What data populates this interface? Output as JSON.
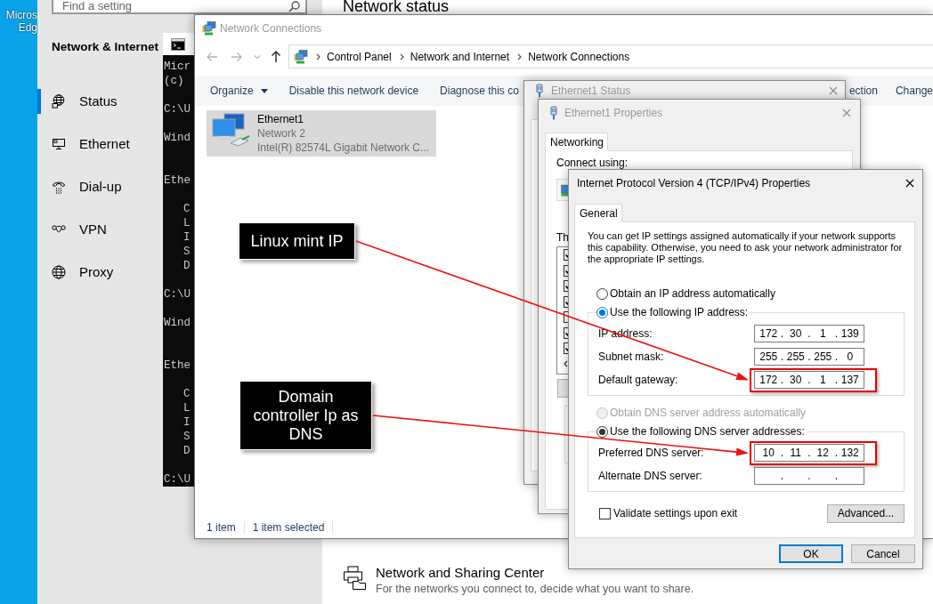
{
  "desktop": {
    "icon_label": [
      "Micros",
      "Edg"
    ]
  },
  "settings": {
    "search_placeholder": "Find a setting",
    "section_title": "Network & Internet",
    "nav": [
      {
        "label": "Status",
        "selected": true
      },
      {
        "label": "Ethernet",
        "selected": false
      },
      {
        "label": "Dial-up",
        "selected": false
      },
      {
        "label": "VPN",
        "selected": false
      },
      {
        "label": "Proxy",
        "selected": false
      }
    ],
    "page_title": "Network status",
    "links": [
      {
        "title": "Network and Sharing Center",
        "description": "For the networks you connect to, decide what you want to share."
      }
    ]
  },
  "terminal": {
    "lines": [
      {
        "kind": "text",
        "text": "Micr"
      },
      {
        "kind": "text",
        "text": "(c)"
      },
      {
        "kind": "blank"
      },
      {
        "kind": "text",
        "text": "C:\\U"
      },
      {
        "kind": "blank"
      },
      {
        "kind": "text",
        "text": "Wind"
      },
      {
        "kind": "blank"
      },
      {
        "kind": "blank"
      },
      {
        "kind": "text",
        "text": "Ethe"
      },
      {
        "kind": "blank"
      },
      {
        "kind": "indented",
        "text": "C"
      },
      {
        "kind": "indented",
        "text": "L"
      },
      {
        "kind": "indented",
        "text": "I"
      },
      {
        "kind": "indented",
        "text": "S"
      },
      {
        "kind": "indented",
        "text": "D"
      },
      {
        "kind": "blank"
      },
      {
        "kind": "text",
        "text": "C:\\U"
      },
      {
        "kind": "blank"
      },
      {
        "kind": "text",
        "text": "Wind"
      },
      {
        "kind": "blank"
      },
      {
        "kind": "blank"
      },
      {
        "kind": "text",
        "text": "Ethe"
      },
      {
        "kind": "blank"
      },
      {
        "kind": "indented",
        "text": "C"
      },
      {
        "kind": "indented",
        "text": "L"
      },
      {
        "kind": "indented",
        "text": "I"
      },
      {
        "kind": "indented",
        "text": "S"
      },
      {
        "kind": "indented",
        "text": "D"
      },
      {
        "kind": "blank"
      },
      {
        "kind": "text",
        "text": "C:\\U"
      }
    ]
  },
  "network_connections": {
    "title": "Network Connections",
    "breadcrumb": [
      "Control Panel",
      "Network and Internet",
      "Network Connections"
    ],
    "toolbar": [
      {
        "label": "Organize",
        "dropdown": true
      },
      {
        "label": "Disable this network device",
        "dropdown": false
      },
      {
        "label": "Diagnose this co",
        "dropdown": false
      },
      {
        "label": "ection",
        "dropdown": false
      },
      {
        "label": "Change",
        "dropdown": false
      }
    ],
    "items": [
      {
        "name": "Ethernet1",
        "network": "Network 2",
        "device": "Intel(R) 82574L Gigabit Network C...",
        "selected": true
      }
    ],
    "status": [
      "1 item",
      "1 item selected"
    ]
  },
  "ethernet_status": {
    "title": "Ethernet1 Status"
  },
  "ethernet_properties": {
    "title": "Ethernet1 Properties",
    "tabs": [
      {
        "label": "Networking",
        "selected": true
      }
    ],
    "connect_label": "Connect using:",
    "items_label": "Th",
    "items": [
      {
        "checked": true
      },
      {
        "checked": true
      },
      {
        "checked": true
      },
      {
        "checked": true
      },
      {
        "checked": false
      },
      {
        "checked": true
      },
      {
        "checked": true
      }
    ]
  },
  "ipv4": {
    "title": "Internet Protocol Version 4 (TCP/IPv4) Properties",
    "tabs": [
      {
        "label": "General",
        "selected": true
      }
    ],
    "intro": "You can get IP settings assigned automatically if your network supports this capability. Otherwise, you need to ask your network administrator for the appropriate IP settings.",
    "separator": ".",
    "sections": [
      {
        "options": [
          {
            "label": "Obtain an IP address automatically",
            "selected": false,
            "disabled": false,
            "focused": false
          },
          {
            "label": "Use the following IP address:",
            "selected": true,
            "disabled": false,
            "focused": true
          }
        ],
        "fields": [
          {
            "label": "IP address:",
            "octets": [
              "172",
              "30",
              "1",
              "139"
            ],
            "highlighted": false
          },
          {
            "label": "Subnet mask:",
            "octets": [
              "255",
              "255",
              "255",
              "0"
            ],
            "highlighted": false
          },
          {
            "label": "Default gateway:",
            "octets": [
              "172",
              "30",
              "1",
              "137"
            ],
            "highlighted": true
          }
        ]
      },
      {
        "options": [
          {
            "label": "Obtain DNS server address automatically",
            "selected": false,
            "disabled": true,
            "focused": false
          },
          {
            "label": "Use the following DNS server addresses:",
            "selected": true,
            "disabled": false,
            "focused": false
          }
        ],
        "fields": [
          {
            "label": "Preferred DNS server:",
            "octets": [
              "10",
              "11",
              "12",
              "132"
            ],
            "highlighted": true
          },
          {
            "label": "Alternate DNS server:",
            "highlighted": false
          }
        ]
      }
    ],
    "validate": {
      "label": "Validate settings upon exit",
      "checked": false
    },
    "advanced_label": "Advanced...",
    "buttons": [
      {
        "label": "OK",
        "default": true
      },
      {
        "label": "Cancel",
        "default": false
      }
    ]
  },
  "annotations": [
    {
      "text": "Linux mint IP"
    },
    {
      "text": "Domain controller Ip as DNS"
    }
  ]
}
